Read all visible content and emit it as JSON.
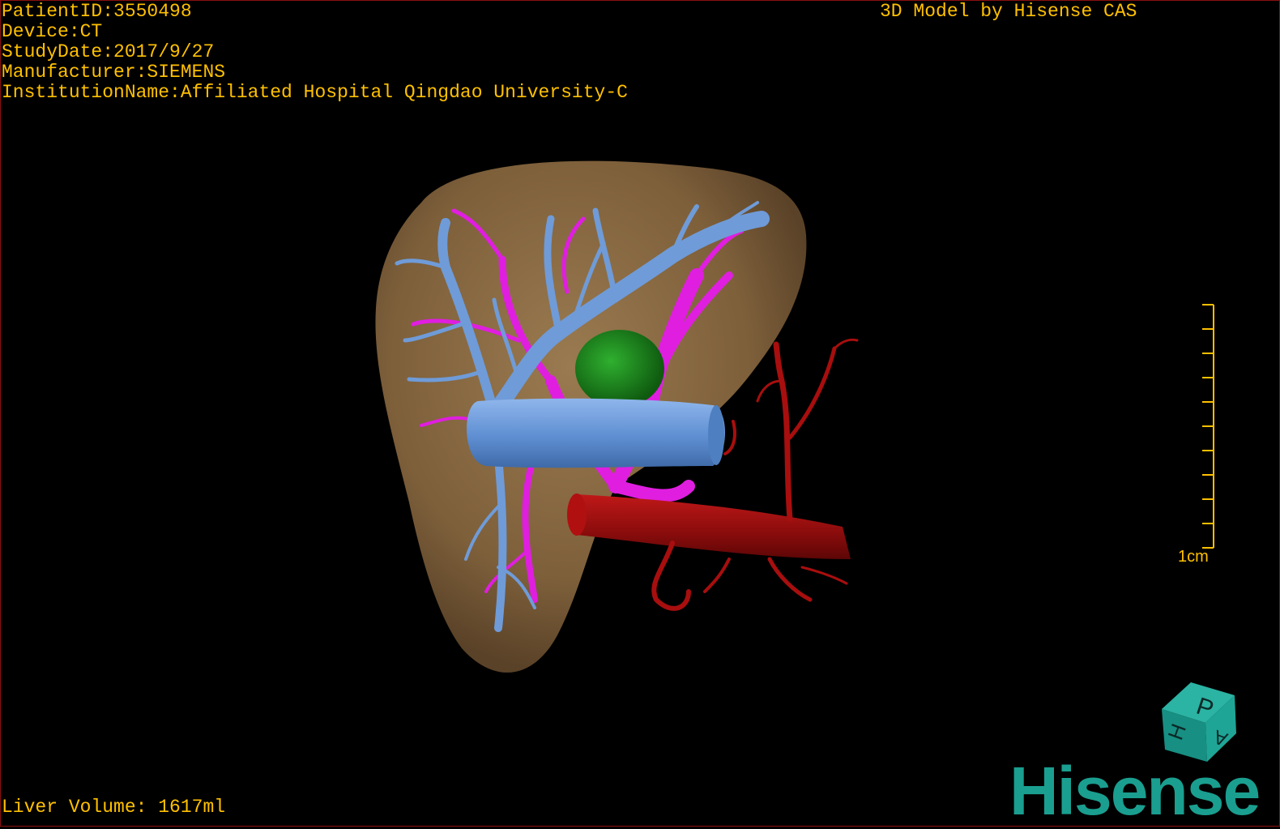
{
  "overlay": {
    "patient_id": "PatientID:3550498",
    "device": "Device:CT",
    "study_date": "StudyDate:2017/9/27",
    "manufacturer": "Manufacturer:SIEMENS",
    "institution": "InstitutionName:Affiliated Hospital Qingdao University-C",
    "credit": "3D Model by Hisense CAS",
    "liver_volume": "Liver Volume: 1617ml"
  },
  "scale_bar": {
    "label": "1cm",
    "ticks": 10
  },
  "orientation_cube": {
    "faces": [
      "P",
      "H",
      "A"
    ]
  },
  "brand": {
    "logo_text": "Hisense"
  },
  "colors": {
    "text": "#ffc000",
    "liver": "#8a6a43",
    "hepatic_vein": "#6f9bd8",
    "portal_vein": "#e01ee0",
    "artery": "#a80e0e",
    "lesion": "#1e8a1e",
    "brand": "#1a9e8f"
  }
}
